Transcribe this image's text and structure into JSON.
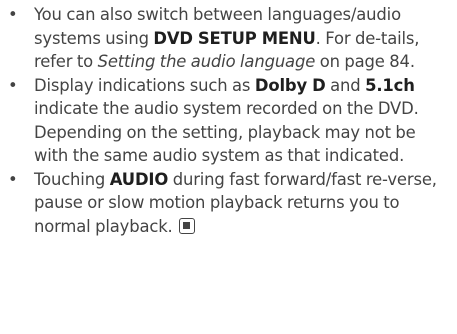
{
  "bullet_glyph": "•",
  "items": [
    {
      "parts": [
        "You can also switch between languages/audio systems using ",
        "DVD SETUP MENU",
        ". For de-tails, refer to ",
        "Setting the audio language",
        " on page 84."
      ]
    },
    {
      "parts": [
        "Display indications such as ",
        "Dolby D",
        " and ",
        "5.1ch",
        " indicate the audio system recorded on the DVD. Depending on the setting, playback may not be with the same audio system as that indicated."
      ]
    },
    {
      "parts": [
        "Touching ",
        "AUDIO",
        " during fast forward/fast re-verse, pause or slow motion playback returns you to normal playback."
      ],
      "end_icon": "stop-icon"
    }
  ]
}
